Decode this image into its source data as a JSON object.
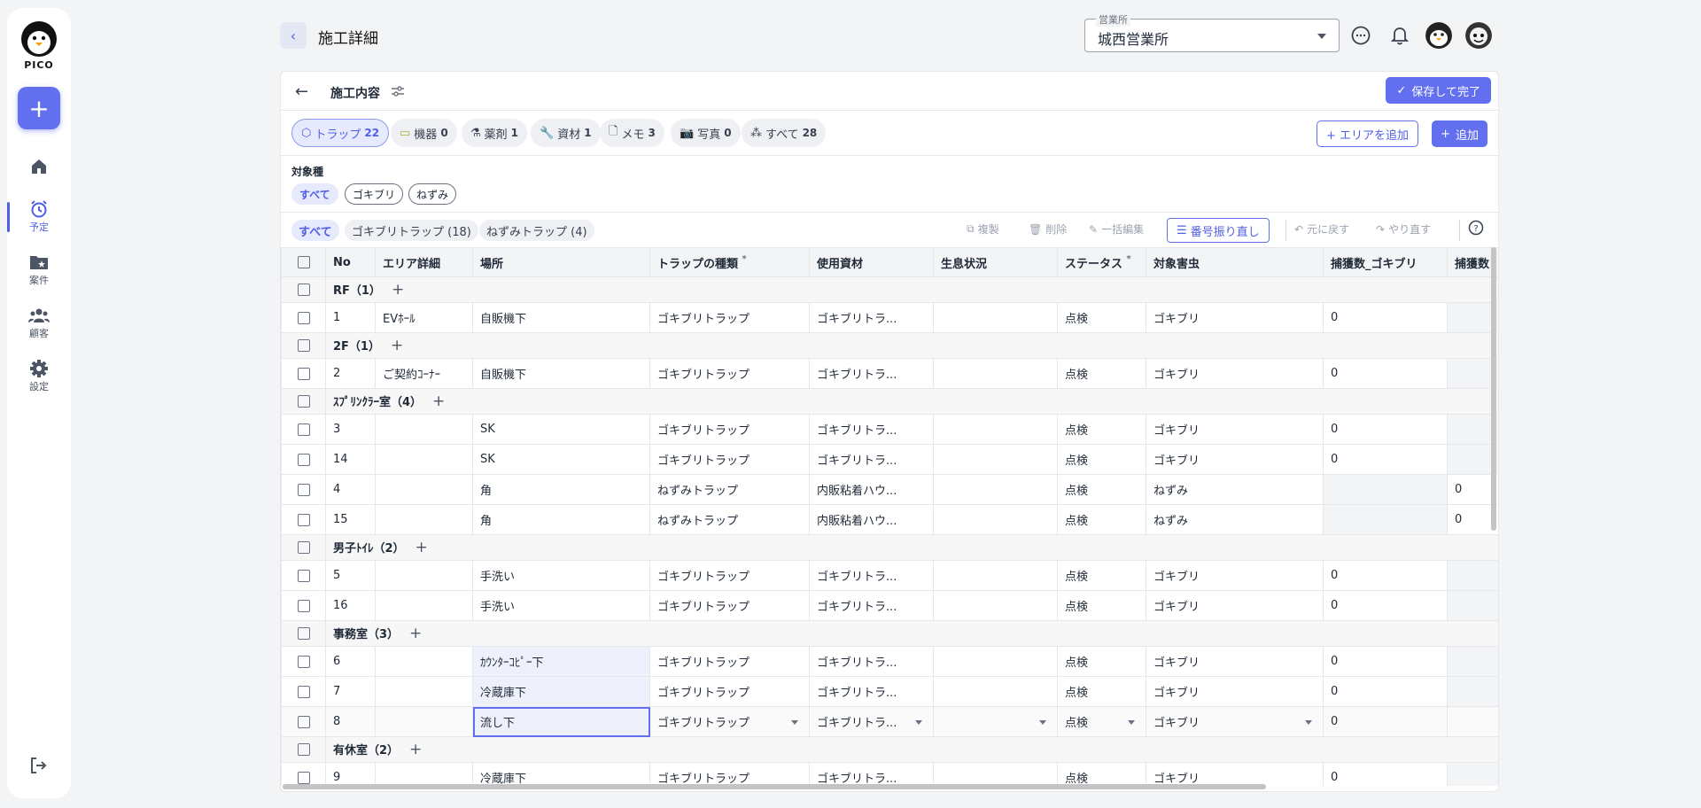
{
  "sidebar": {
    "logo_text": "PICO",
    "nav": [
      {
        "label": "",
        "icon": "home-icon"
      },
      {
        "label": "予定",
        "icon": "alarm-clock-icon"
      },
      {
        "label": "案件",
        "icon": "folder-star-icon"
      },
      {
        "label": "顧客",
        "icon": "people-icon"
      },
      {
        "label": "設定",
        "icon": "gear-icon"
      }
    ]
  },
  "header": {
    "title": "施工詳細",
    "office_label": "営業所",
    "office_value": "城西営業所"
  },
  "card": {
    "title": "施工内容",
    "save_label": "保存して完了",
    "categories": [
      {
        "label": "トラップ",
        "count": "22"
      },
      {
        "label": "機器",
        "count": "0"
      },
      {
        "label": "薬剤",
        "count": "1"
      },
      {
        "label": "資材",
        "count": "1"
      },
      {
        "label": "メモ",
        "count": "3"
      },
      {
        "label": "写真",
        "count": "0"
      },
      {
        "label": "すべて",
        "count": "28"
      }
    ],
    "add_area_label": "+ エリアを追加",
    "add_label": "追加",
    "species_label": "対象種",
    "species": [
      "すべて",
      "ゴキブリ",
      "ねずみ"
    ],
    "trap_filters": [
      "すべて",
      "ゴキブリトラップ (18)",
      "ねずみトラップ (4)"
    ],
    "tools": {
      "copy": "複製",
      "delete": "削除",
      "bulk_edit": "一括編集",
      "renumber": "番号振り直し",
      "undo": "元に戻す",
      "redo": "やり直す"
    }
  },
  "table": {
    "headers": [
      "No",
      "エリア詳細",
      "場所",
      "トラップの種類",
      "使用資材",
      "生息状況",
      "ステータス",
      "対象害虫",
      "捕獲数_ゴキブリ",
      "捕獲数"
    ],
    "groups": [
      {
        "name": "RF（1）",
        "rows": [
          {
            "no": "1",
            "area": "EVﾎｰﾙ",
            "place": "自販機下",
            "trap": "ゴキブリトラップ",
            "material": "ゴキブリトラ...",
            "habitat": "",
            "status": "点検",
            "pest": "ゴキブリ",
            "cap1": "0",
            "cap2": ""
          }
        ]
      },
      {
        "name": "2F（1）",
        "rows": [
          {
            "no": "2",
            "area": "ご契約ｺｰﾅｰ",
            "place": "自販機下",
            "trap": "ゴキブリトラップ",
            "material": "ゴキブリトラ...",
            "habitat": "",
            "status": "点検",
            "pest": "ゴキブリ",
            "cap1": "0",
            "cap2": ""
          }
        ]
      },
      {
        "name": "ｽﾌﾟﾘﾝｸﾗｰ室（4）",
        "rows": [
          {
            "no": "3",
            "area": "",
            "place": "SK",
            "trap": "ゴキブリトラップ",
            "material": "ゴキブリトラ...",
            "habitat": "",
            "status": "点検",
            "pest": "ゴキブリ",
            "cap1": "0",
            "cap2": ""
          },
          {
            "no": "14",
            "area": "",
            "place": "SK",
            "trap": "ゴキブリトラップ",
            "material": "ゴキブリトラ...",
            "habitat": "",
            "status": "点検",
            "pest": "ゴキブリ",
            "cap1": "0",
            "cap2": ""
          },
          {
            "no": "4",
            "area": "",
            "place": "角",
            "trap": "ねずみトラップ",
            "material": "内販粘着ハウ...",
            "habitat": "",
            "status": "点検",
            "pest": "ねずみ",
            "cap1": "",
            "cap2": "0"
          },
          {
            "no": "15",
            "area": "",
            "place": "角",
            "trap": "ねずみトラップ",
            "material": "内販粘着ハウ...",
            "habitat": "",
            "status": "点検",
            "pest": "ねずみ",
            "cap1": "",
            "cap2": "0"
          }
        ]
      },
      {
        "name": "男子ﾄｲﾚ（2）",
        "rows": [
          {
            "no": "5",
            "area": "",
            "place": "手洗い",
            "trap": "ゴキブリトラップ",
            "material": "ゴキブリトラ...",
            "habitat": "",
            "status": "点検",
            "pest": "ゴキブリ",
            "cap1": "0",
            "cap2": ""
          },
          {
            "no": "16",
            "area": "",
            "place": "手洗い",
            "trap": "ゴキブリトラップ",
            "material": "ゴキブリトラ...",
            "habitat": "",
            "status": "点検",
            "pest": "ゴキブリ",
            "cap1": "0",
            "cap2": ""
          }
        ]
      },
      {
        "name": "事務室（3）",
        "rows": [
          {
            "no": "6",
            "area": "",
            "place": "ｶｳﾝﾀｰｺﾋﾟｰ下",
            "trap": "ゴキブリトラップ",
            "material": "ゴキブリトラ...",
            "habitat": "",
            "status": "点検",
            "pest": "ゴキブリ",
            "cap1": "0",
            "cap2": ""
          },
          {
            "no": "7",
            "area": "",
            "place": "冷蔵庫下",
            "trap": "ゴキブリトラップ",
            "material": "ゴキブリトラ...",
            "habitat": "",
            "status": "点検",
            "pest": "ゴキブリ",
            "cap1": "0",
            "cap2": ""
          },
          {
            "no": "8",
            "area": "",
            "place": "流し下",
            "trap": "ゴキブリトラップ",
            "material": "ゴキブリトラ...",
            "habitat": "",
            "status": "点検",
            "pest": "ゴキブリ",
            "cap1": "0",
            "cap2": ""
          }
        ]
      },
      {
        "name": "有休室（2）",
        "rows": [
          {
            "no": "9",
            "area": "",
            "place": "冷蔵庫下",
            "trap": "ゴキブリトラップ",
            "material": "ゴキブリトラ...",
            "habitat": "",
            "status": "点検",
            "pest": "ゴキブリ",
            "cap1": "0",
            "cap2": ""
          }
        ]
      }
    ]
  }
}
